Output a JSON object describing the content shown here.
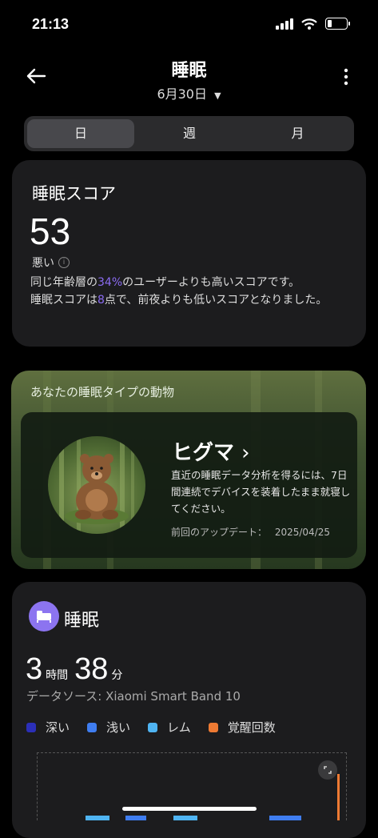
{
  "status_bar": {
    "time": "21:13"
  },
  "header": {
    "title": "睡眠",
    "date": "6月30日"
  },
  "segments": [
    "日",
    "週",
    "月"
  ],
  "score_card": {
    "title": "睡眠スコア",
    "score": "53",
    "level": "悪い",
    "line1_pre": "同じ年齢層の",
    "line1_pct": "34%",
    "line1_post": "のユーザーよりも高いスコアです。",
    "line2_pre": "睡眠スコアは",
    "line2_num": "8",
    "line2_post": "点で、前夜よりも低いスコアとなりました。"
  },
  "animal_card": {
    "heading": "あなたの睡眠タイプの動物",
    "name": "ヒグマ",
    "description": "直近の睡眠データ分析を得るには、7日間連続でデバイスを装着したまま就寝してください。",
    "updated_label": "前回のアップデート：",
    "updated_date": "2025/04/25"
  },
  "sleep_card": {
    "title": "睡眠",
    "hours": "3",
    "hours_unit": "時間",
    "minutes": "38",
    "minutes_unit": "分",
    "source": "データソース: Xiaomi Smart Band 10",
    "legend": [
      {
        "label": "深い",
        "color": "#2b2fb8"
      },
      {
        "label": "浅い",
        "color": "#3f7df0"
      },
      {
        "label": "レム",
        "color": "#4fb4f2"
      },
      {
        "label": "覚醒回数",
        "color": "#ee7a33"
      }
    ]
  }
}
